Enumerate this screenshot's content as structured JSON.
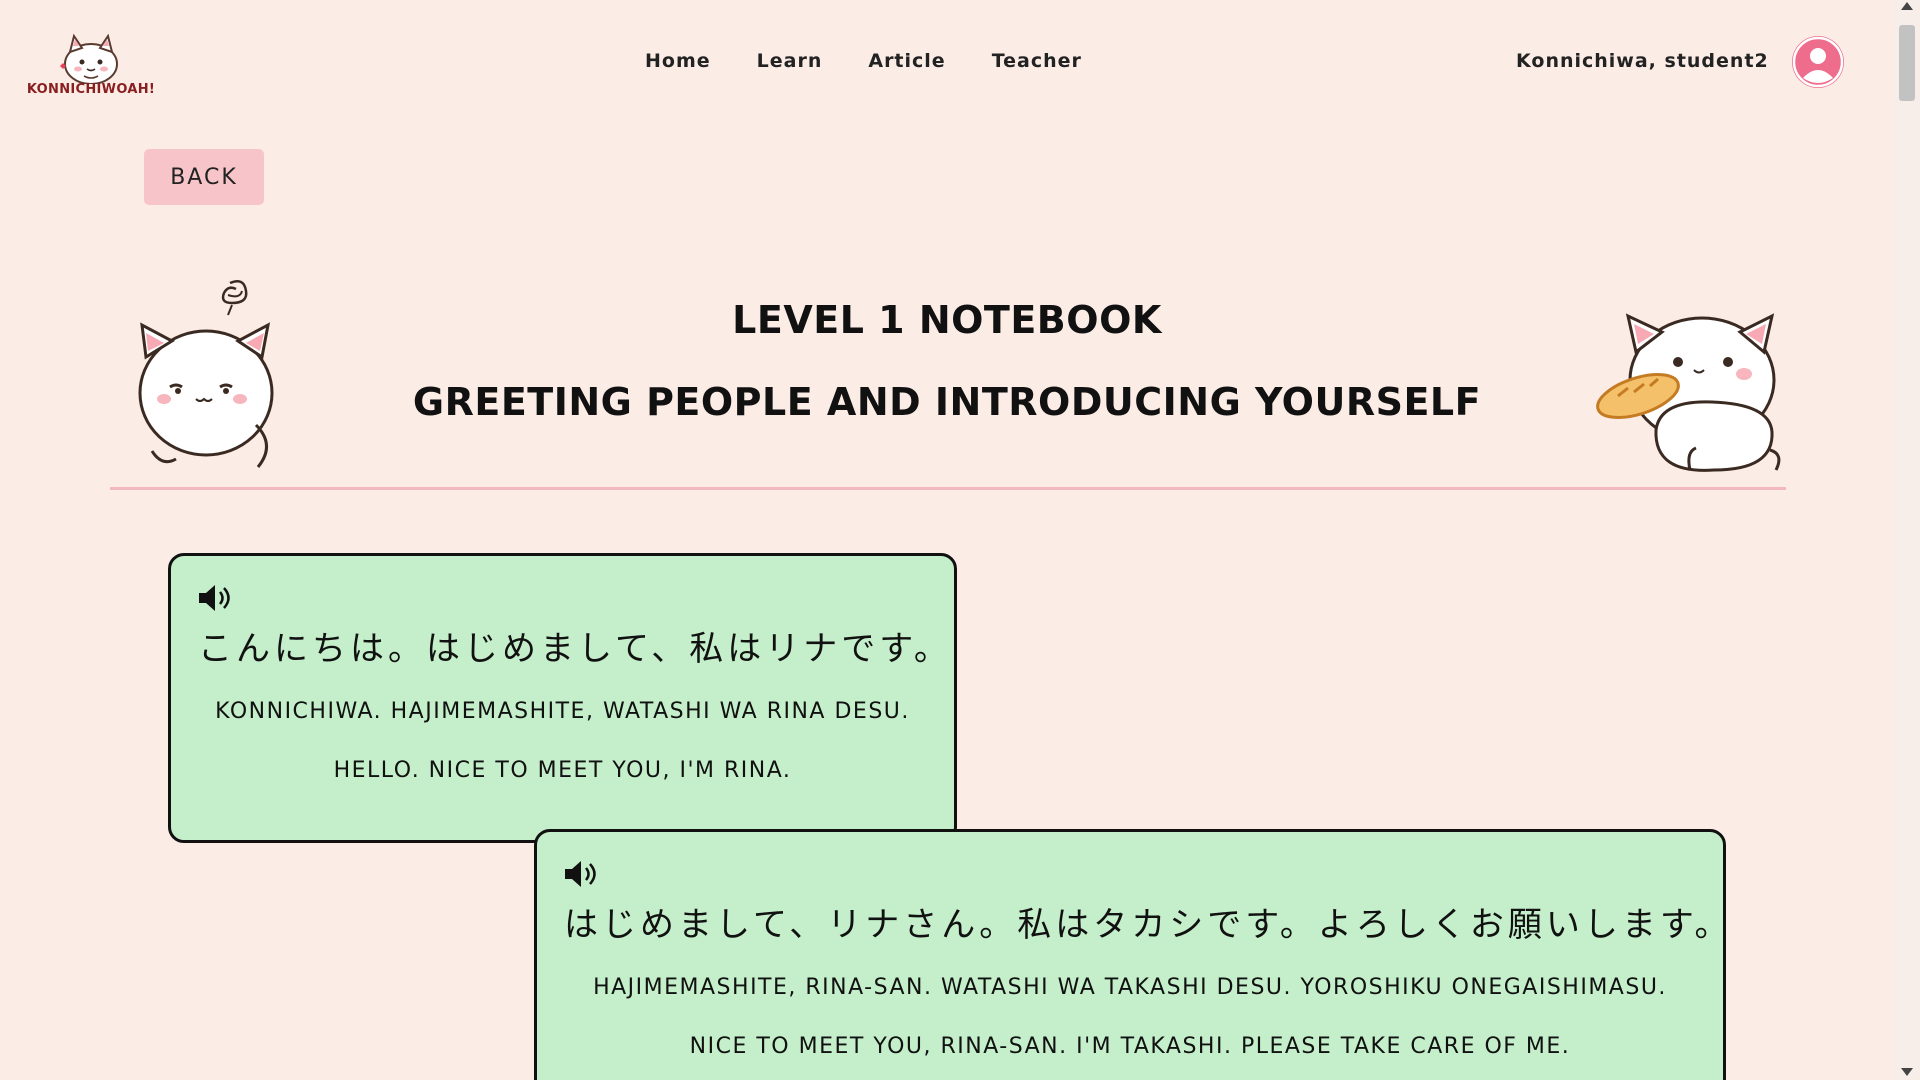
{
  "header": {
    "logo_text": "KONNICHIWOAH!",
    "nav": [
      {
        "label": "Home"
      },
      {
        "label": "Learn"
      },
      {
        "label": "Article"
      },
      {
        "label": "Teacher"
      }
    ],
    "greeting": "Konnichiwa, student2",
    "avatar_icon": "user-avatar-icon"
  },
  "back_label": "BACK",
  "titles": {
    "level": "LEVEL 1 NOTEBOOK",
    "topic": "GREETING PEOPLE AND INTRODUCING YOURSELF"
  },
  "cards": [
    {
      "japanese": "こんにちは。はじめまして、私はリナです。",
      "romaji": "KONNICHIWA. HAJIMEMASHITE, WATASHI WA RINA DESU.",
      "english": "HELLO. NICE TO MEET YOU, I'M RINA.",
      "icon": "speaker-icon"
    },
    {
      "japanese": "はじめまして、リナさん。私はタカシです。よろしくお願いします。",
      "romaji": "HAJIMEMASHITE, RINA-SAN. WATASHI WA TAKASHI DESU. YOROSHIKU ONEGAISHIMASU.",
      "english": "NICE TO MEET YOU, RINA-SAN. I'M TAKASHI. PLEASE TAKE CARE OF ME.",
      "icon": "speaker-icon"
    }
  ],
  "colors": {
    "background": "#fbece6",
    "card": "#c4efca",
    "accent_pink": "#f7c5c9",
    "avatar": "#ee6c8c",
    "divider": "#f3b8bf"
  }
}
